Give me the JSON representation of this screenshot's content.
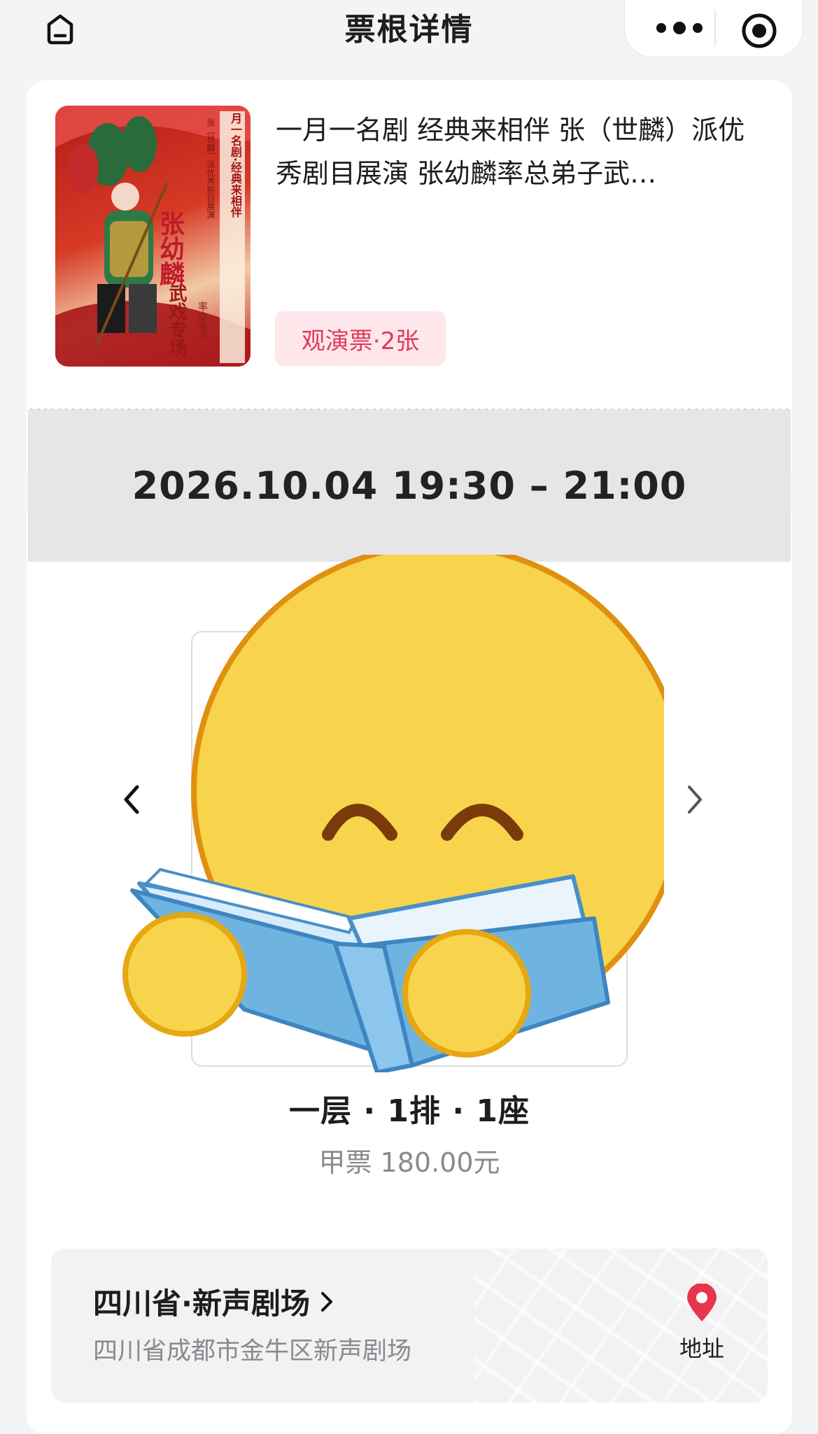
{
  "header": {
    "title": "票根详情",
    "icons": {
      "home": "home-icon",
      "more": "more-dots-icon",
      "close": "target-close-icon"
    }
  },
  "event": {
    "title": "一月一名剧 经典来相伴 张（世麟）派优秀剧目展演 张幼麟率总弟子武…",
    "poster": {
      "lines": [
        "月一名剧·经典来相伴",
        "张（世麟）派优秀剧目展演",
        "张幼麟",
        "率众弟子",
        "武戏专场"
      ],
      "colors": {
        "primary": "#b31b19",
        "accent": "#f2c9a5"
      }
    },
    "ticket_tag": "观演票·2张"
  },
  "schedule": {
    "time_range": "2026.10.04 19:30 – 21:00"
  },
  "ticket": {
    "seat": "一层 · 1排 · 1座",
    "price": "甲票 180.00元",
    "overlay_icon": "reading-emoji-icon"
  },
  "venue": {
    "name": "四川省·新声剧场",
    "address": "四川省成都市金牛区新声剧场",
    "address_button": "地址",
    "pin_color": "#e8354f"
  },
  "colors": {
    "accent": "#e2395b",
    "tag_bg": "#fde7ea",
    "muted": "#8a8a8e",
    "band": "#e6e6e8"
  }
}
